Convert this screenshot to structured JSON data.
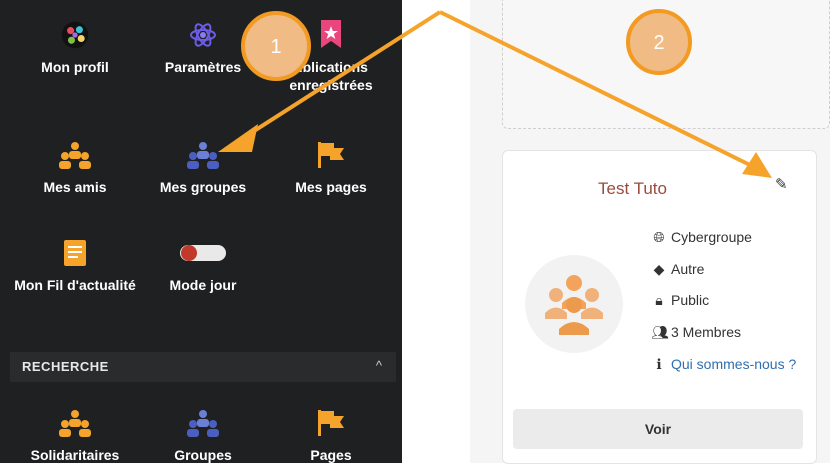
{
  "sidebar": {
    "tiles": [
      {
        "label": "Mon profil",
        "icon": "profile-avatar-icon"
      },
      {
        "label": "Paramètres",
        "icon": "settings-atom-icon"
      },
      {
        "label": "ublications enregistrées",
        "icon": "bookmark-icon"
      },
      {
        "label": "Mes amis",
        "icon": "friends-icon"
      },
      {
        "label": "Mes groupes",
        "icon": "groups-icon"
      },
      {
        "label": "Mes pages",
        "icon": "flag-icon"
      },
      {
        "label": "Mon Fil d'actualité",
        "icon": "newsfeed-icon"
      },
      {
        "label": "Mode jour",
        "icon": "toggle-icon"
      },
      {
        "label": "Solidaritaires",
        "icon": "friends-icon"
      },
      {
        "label": "Groupes",
        "icon": "groups-icon"
      },
      {
        "label": "Pages",
        "icon": "flag-icon"
      }
    ],
    "section": {
      "title": "RECHERCHE",
      "chevron": "^"
    }
  },
  "group_card": {
    "title": "Test Tuto",
    "category": "Cybergroupe",
    "type": "Autre",
    "privacy": "Public",
    "members": "3 Membres",
    "about_link": "Qui sommes-nous ?",
    "view_button": "Voir"
  },
  "annotations": {
    "badge1": "1",
    "badge2": "2"
  },
  "colors": {
    "sidebar_bg": "#1f2021",
    "accent_orange": "#f5a32a",
    "group_blue": "#4a5fc1",
    "title_red": "#9b4b3e",
    "link_blue": "#2f6fb0"
  }
}
